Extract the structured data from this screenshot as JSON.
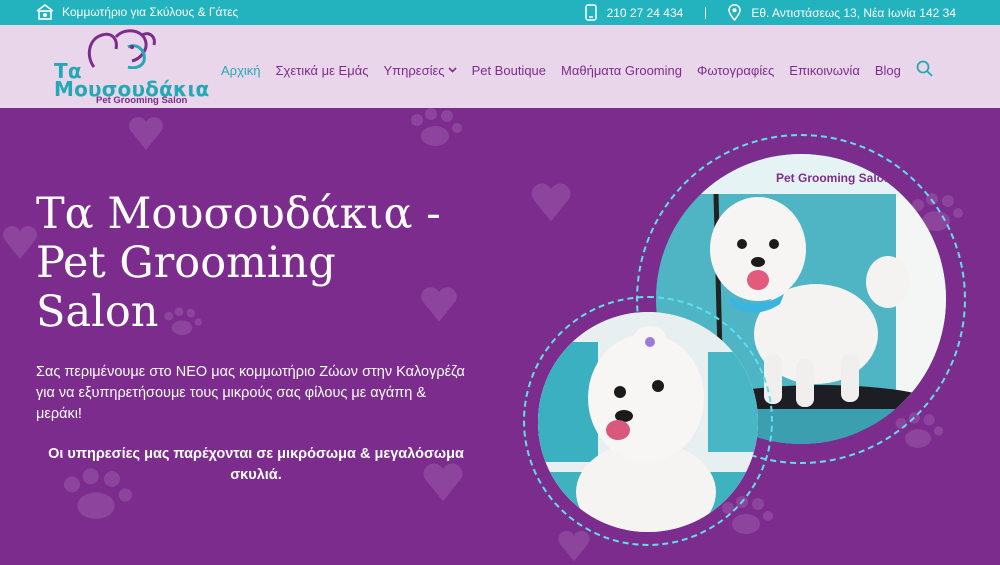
{
  "topbar": {
    "tagline": "Κομμωτήριο για Σκύλους & Γάτες",
    "phone": "210 27 24 434",
    "address": "Εθ. Αντιστάσεως 13, Νέα Ιωνία 142 34"
  },
  "logo": {
    "line1": "Τα",
    "line2": "Μουσουδάκια",
    "subtitle": "Pet Grooming Salon"
  },
  "nav": {
    "items": [
      "Αρχική",
      "Σχετικά με Εμάς",
      "Υπηρεσίες",
      "Pet Boutique",
      "Μαθήματα Grooming",
      "Φωτογραφίες",
      "Επικοινωνία",
      "Blog"
    ]
  },
  "hero": {
    "title": "Τα Μουσουδάκια - Pet Grooming Salon",
    "text": "Σας περιμένουμε στο ΝΕΟ μας κομμωτήριο Ζώων στην Καλογρέζα για να εξυπηρετήσουμε τους μικρούς σας φίλους με αγάπη & μεράκι!",
    "bold": "Οι υπηρεσίες μας παρέχονται σε μικρόσωμα & μεγαλόσωμα σκυλιά.",
    "photo_sign": "Pet Grooming Salon"
  },
  "colors": {
    "teal": "#23b3bf",
    "purple": "#7c2c8c",
    "header_bg": "#ead6ea"
  }
}
